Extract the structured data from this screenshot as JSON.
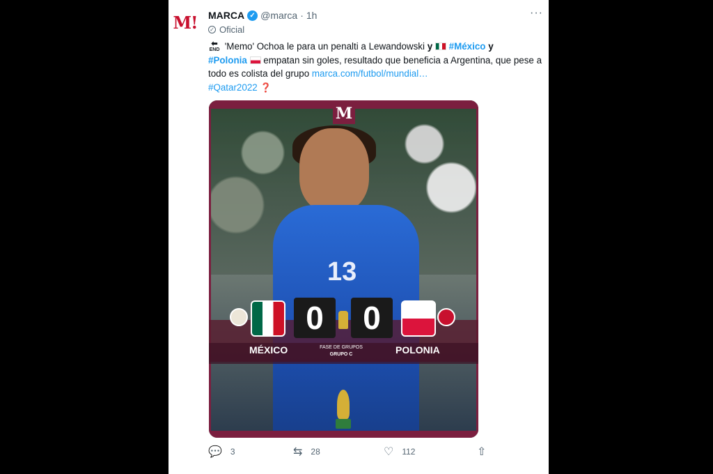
{
  "tweet": {
    "avatar_logo": "M!",
    "name": "MARCA",
    "handle": "@marca",
    "separator": "·",
    "time": "1h",
    "more": "···",
    "official": "Oficial",
    "text": {
      "end_icon_label": "END",
      "part1": "'Memo' Ochoa le para un penalti a Lewandowski",
      "y1": "y",
      "hashtag_mexico": "#México",
      "y2": "y",
      "hashtag_polonia": "#Polonia",
      "part2": "empatan sin goles, resultado que beneficia a Argentina, que pese a todo es colista del grupo",
      "link": "marca.com/futbol/mundial…",
      "hashtag_qatar": "#Qatar2022"
    },
    "media": {
      "badge": "M",
      "jersey_number": "13",
      "home_team": "MÉXICO",
      "away_team": "POLONIA",
      "home_score": "0",
      "away_score": "0",
      "stage": "FASE DE GRUPOS",
      "group": "GRUPO C"
    },
    "actions": {
      "replies": "3",
      "retweets": "28",
      "likes": "112"
    },
    "colors": {
      "verified": "#1d9bf0",
      "link": "#1d9bf0",
      "marca_red": "#c8102e",
      "frame": "#7b1f3f"
    }
  }
}
